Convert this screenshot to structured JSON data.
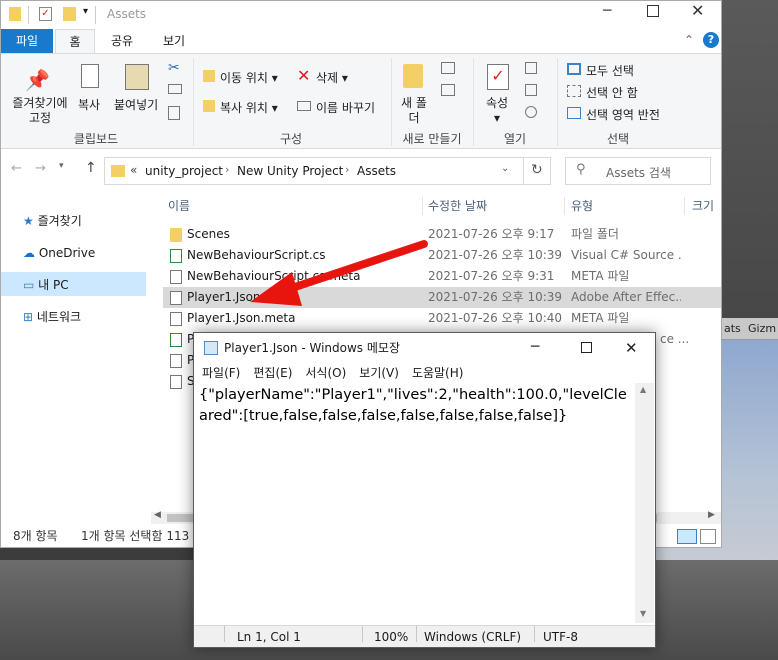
{
  "explorer": {
    "title": "Assets",
    "ribbon_tabs": [
      "파일",
      "홈",
      "공유",
      "보기"
    ],
    "clipboard": {
      "pin_label": "즐겨찾기에 고정",
      "copy_label": "복사",
      "paste_label": "붙여넣기",
      "group_label": "클립보드"
    },
    "organize": {
      "move_label": "이동 위치",
      "copy_to_label": "복사 위치",
      "delete_label": "삭제",
      "rename_label": "이름 바꾸기",
      "group_label": "구성"
    },
    "new": {
      "new_folder_label": "새 폴더",
      "group_label": "새로 만들기"
    },
    "open": {
      "properties_label": "속성",
      "group_label": "열기"
    },
    "select": {
      "select_all_label": "모두 선택",
      "select_none_label": "선택 안 함",
      "invert_label": "선택 영역 반전",
      "group_label": "선택"
    },
    "address": {
      "chevron": "«",
      "crumbs": [
        "unity_project",
        "New Unity Project",
        "Assets"
      ]
    },
    "search_placeholder": "Assets 검색",
    "nav": [
      "즐겨찾기",
      "OneDrive",
      "내 PC",
      "네트워크"
    ],
    "columns": {
      "name": "이름",
      "date": "수정한 날짜",
      "type": "유형",
      "size": "크기"
    },
    "files": [
      {
        "name": "Scenes",
        "date": "2021-07-26 오후 9:17",
        "type": "파일 폴더",
        "icon": "folder-icon"
      },
      {
        "name": "NewBehaviourScript.cs",
        "date": "2021-07-26 오후 10:39",
        "type": "Visual C# Source ...",
        "icon": "cs-file-icon"
      },
      {
        "name": "NewBehaviourScript.cs.meta",
        "date": "2021-07-26 오후 9:31",
        "type": "META 파일",
        "icon": "file-icon"
      },
      {
        "name": "Player1.Json",
        "date": "2021-07-26 오후 10:39",
        "type": "Adobe After Effec...",
        "icon": "json-file-icon"
      },
      {
        "name": "Player1.Json.meta",
        "date": "2021-07-26 오후 10:40",
        "type": "META 파일",
        "icon": "file-icon"
      },
      {
        "name": "P",
        "date": "",
        "type": "ce ...",
        "icon": "cs-file-icon"
      },
      {
        "name": "P",
        "date": "",
        "type": "",
        "icon": "file-icon"
      },
      {
        "name": "S",
        "date": "",
        "type": "",
        "icon": "file-icon"
      }
    ],
    "status": {
      "count": "8개 항목",
      "selected": "1개 항목 선택함 113"
    }
  },
  "unity": {
    "tab_stats": "ats",
    "tab_gizmos": "Gizm"
  },
  "notepad": {
    "title": "Player1.Json - Windows 메모장",
    "menu": [
      "파일(F)",
      "편집(E)",
      "서식(O)",
      "보기(V)",
      "도움말(H)"
    ],
    "content": "{\"playerName\":\"Player1\",\"lives\":2,\"health\":100.0,\"levelCleared\":[true,false,false,false,false,false,false,false]}",
    "status": {
      "position": "Ln 1, Col 1",
      "zoom": "100%",
      "line_ending": "Windows (CRLF)",
      "encoding": "UTF-8"
    }
  },
  "colors": {
    "accent": "#1979ca",
    "arrow": "#e8150f",
    "selection": "#d9d9d9"
  }
}
